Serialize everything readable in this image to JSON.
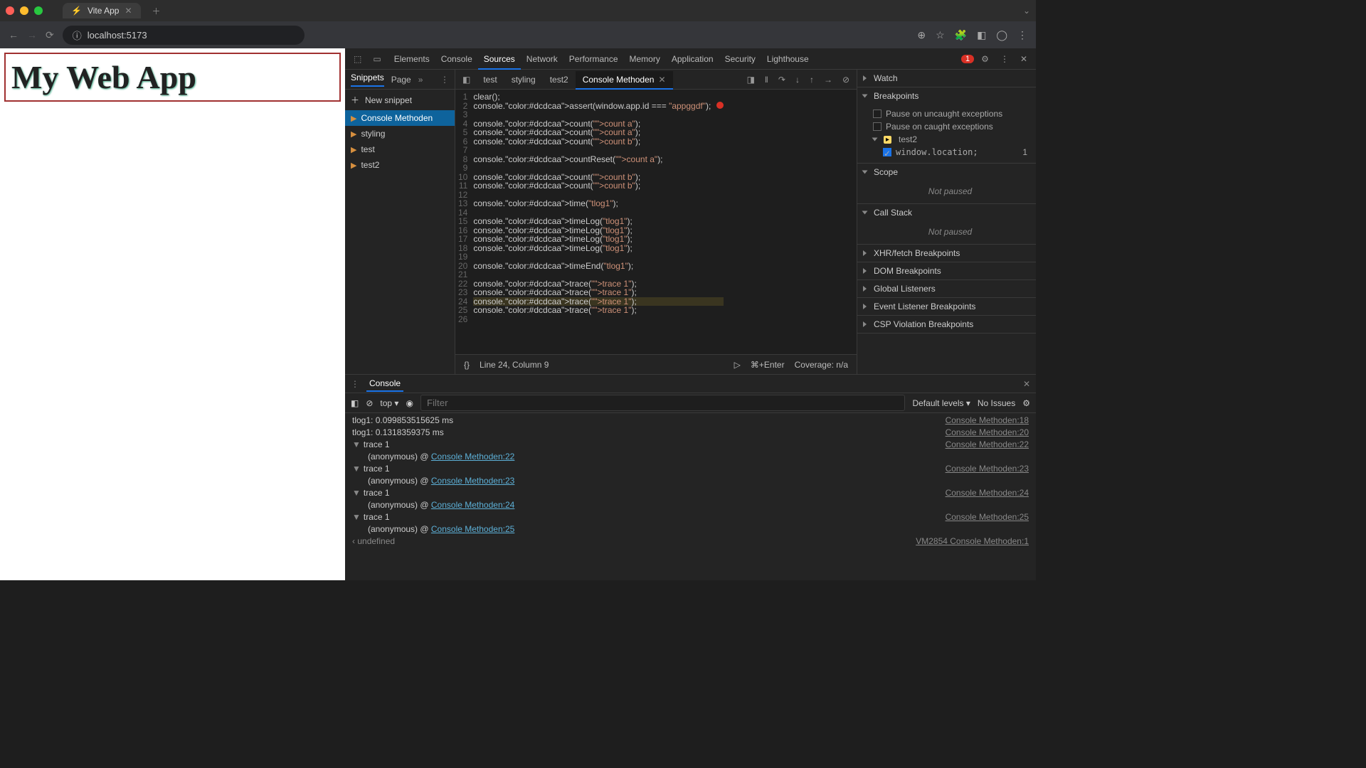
{
  "browser": {
    "tab_title": "Vite App",
    "url": "localhost:5173"
  },
  "page": {
    "heading": "My Web App"
  },
  "devtools": {
    "tabs": [
      "Elements",
      "Console",
      "Sources",
      "Network",
      "Performance",
      "Memory",
      "Application",
      "Security",
      "Lighthouse"
    ],
    "active_tab": "Sources",
    "error_count": "1"
  },
  "snippets": {
    "tabs": [
      "Snippets",
      "Page"
    ],
    "new_label": "New snippet",
    "items": [
      "Console Methoden",
      "styling",
      "test",
      "test2"
    ],
    "selected": "Console Methoden"
  },
  "editor": {
    "tabs": [
      "test",
      "styling",
      "test2",
      "Console Methoden"
    ],
    "active": "Console Methoden",
    "lines": [
      "clear();",
      "console.assert(window.app.id === \"appggdf\");",
      "",
      "console.count(\"count a\");",
      "console.count(\"count a\");",
      "console.count(\"count b\");",
      "",
      "console.countReset(\"count a\");",
      "",
      "console.count(\"count b\");",
      "console.count(\"count b\");",
      "",
      "console.time(\"tlog1\");",
      "",
      "console.timeLog(\"tlog1\");",
      "console.timeLog(\"tlog1\");",
      "console.timeLog(\"tlog1\");",
      "console.timeLog(\"tlog1\");",
      "",
      "console.timeEnd(\"tlog1\");",
      "",
      "console.trace(\"trace 1\");",
      "console.trace(\"trace 1\");",
      "console.trace(\"trace 1\");",
      "console.trace(\"trace 1\");",
      ""
    ],
    "highlight_line": 24,
    "status": "Line 24, Column 9",
    "run_hint": "⌘+Enter",
    "coverage": "Coverage: n/a"
  },
  "debugger": {
    "sections": {
      "watch": "Watch",
      "breakpoints": "Breakpoints",
      "bp_uncaught": "Pause on uncaught exceptions",
      "bp_caught": "Pause on caught exceptions",
      "bp_group": "test2",
      "bp_item": "window.location;",
      "bp_item_line": "1",
      "scope": "Scope",
      "not_paused": "Not paused",
      "callstack": "Call Stack",
      "xhr": "XHR/fetch Breakpoints",
      "dom": "DOM Breakpoints",
      "global": "Global Listeners",
      "event": "Event Listener Breakpoints",
      "csp": "CSP Violation Breakpoints"
    }
  },
  "console": {
    "tab": "Console",
    "context": "top",
    "filter_placeholder": "Filter",
    "levels": "Default levels",
    "issues": "No Issues",
    "logs": [
      {
        "msg": "tlog1: 0.099853515625 ms",
        "src": "Console Methoden:18"
      },
      {
        "msg": "tlog1: 0.1318359375 ms",
        "src": "Console Methoden:20"
      },
      {
        "trace": "trace 1",
        "anon": "(anonymous) @",
        "link": "Console Methoden:22",
        "src": "Console Methoden:22"
      },
      {
        "trace": "trace 1",
        "anon": "(anonymous) @",
        "link": "Console Methoden:23",
        "src": "Console Methoden:23"
      },
      {
        "trace": "trace 1",
        "anon": "(anonymous) @",
        "link": "Console Methoden:24",
        "src": "Console Methoden:24"
      },
      {
        "trace": "trace 1",
        "anon": "(anonymous) @",
        "link": "Console Methoden:25",
        "src": "Console Methoden:25"
      }
    ],
    "undefined": "undefined",
    "undefined_src": "VM2854 Console Methoden:1"
  }
}
